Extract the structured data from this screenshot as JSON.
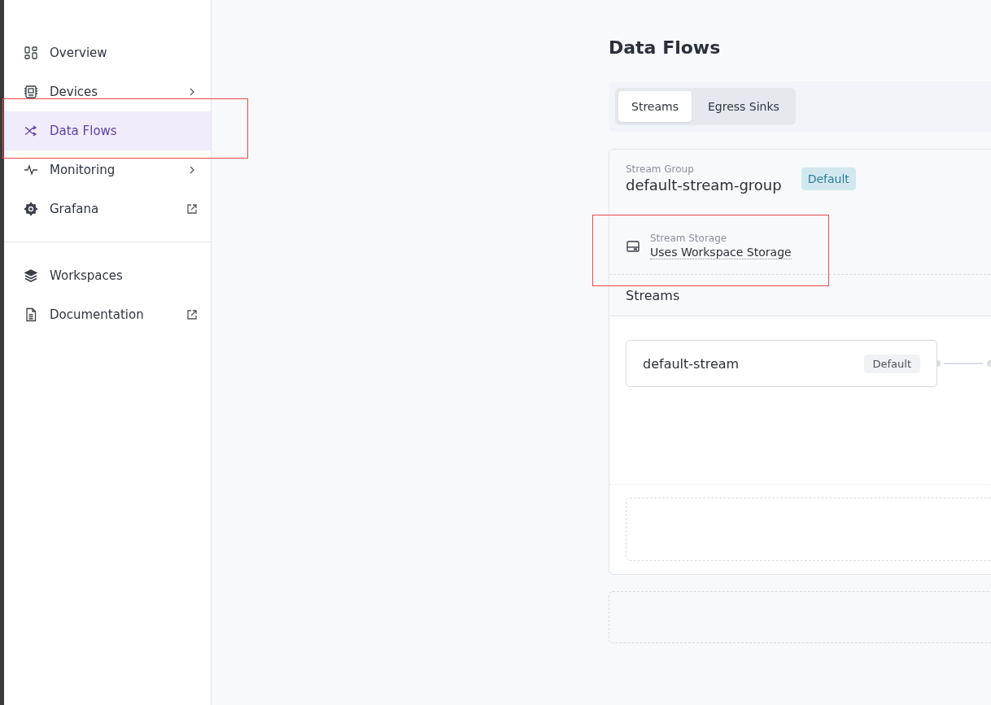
{
  "sidebar": {
    "items": [
      {
        "label": "Overview",
        "selected": false,
        "kind": "link"
      },
      {
        "label": "Devices",
        "selected": false,
        "kind": "submenu"
      },
      {
        "label": "Data Flows",
        "selected": true,
        "kind": "link"
      },
      {
        "label": "Monitoring",
        "selected": false,
        "kind": "submenu"
      },
      {
        "label": "Grafana",
        "selected": false,
        "kind": "external"
      }
    ],
    "bottom_items": [
      {
        "label": "Workspaces",
        "selected": false,
        "kind": "link"
      },
      {
        "label": "Documentation",
        "selected": false,
        "kind": "external"
      }
    ]
  },
  "page": {
    "title": "Data Flows",
    "tabs": [
      {
        "label": "Streams",
        "selected": true
      },
      {
        "label": "Egress Sinks",
        "selected": false
      }
    ],
    "stream_group": {
      "caption": "Stream Group",
      "name": "default-stream-group",
      "badge": "Default",
      "storage": {
        "caption": "Stream Storage",
        "value": "Uses Workspace Storage"
      },
      "streams_heading": "Streams",
      "streams": [
        {
          "name": "default-stream",
          "badge": "Default"
        }
      ]
    }
  }
}
